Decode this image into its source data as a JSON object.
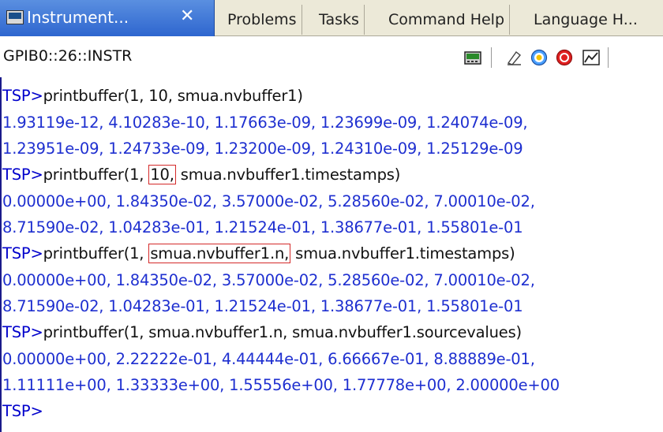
{
  "tabs": {
    "active": {
      "label": "Instrument...",
      "close": "✕"
    },
    "others": [
      "Problems",
      "Tasks",
      "Command Help",
      "Language H..."
    ]
  },
  "toolbar": {
    "address": "GPIB0::26::INSTR"
  },
  "console": {
    "prompt": "TSP>",
    "lines": [
      {
        "type": "cmd",
        "text": "printbuffer(1, 10, smua.nvbuffer1)"
      },
      {
        "type": "out",
        "text": "1.93119e-12, 4.10283e-10, 1.17663e-09, 1.23699e-09, 1.24074e-09,"
      },
      {
        "type": "out",
        "text": "1.23951e-09, 1.24733e-09, 1.23200e-09, 1.24310e-09, 1.25129e-09"
      },
      {
        "type": "cmd",
        "pre": "printbuffer(1, ",
        "highlight": "10,",
        "post": " smua.nvbuffer1.timestamps)"
      },
      {
        "type": "out",
        "text": "0.00000e+00, 1.84350e-02, 3.57000e-02, 5.28560e-02, 7.00010e-02,"
      },
      {
        "type": "out",
        "text": "8.71590e-02, 1.04283e-01, 1.21524e-01, 1.38677e-01, 1.55801e-01"
      },
      {
        "type": "cmd",
        "pre": "printbuffer(1, ",
        "highlight": "smua.nvbuffer1.n,",
        "post": " smua.nvbuffer1.timestamps)"
      },
      {
        "type": "out",
        "text": "0.00000e+00, 1.84350e-02, 3.57000e-02, 5.28560e-02, 7.00010e-02,"
      },
      {
        "type": "out",
        "text": "8.71590e-02, 1.04283e-01, 1.21524e-01, 1.38677e-01, 1.55801e-01"
      },
      {
        "type": "cmd",
        "text": "printbuffer(1, smua.nvbuffer1.n, smua.nvbuffer1.sourcevalues)"
      },
      {
        "type": "out",
        "text": "0.00000e+00, 2.22222e-01, 4.44444e-01, 6.66667e-01, 8.88889e-01,"
      },
      {
        "type": "out",
        "text": "1.11111e+00, 1.33333e+00, 1.55556e+00, 1.77778e+00, 2.00000e+00"
      },
      {
        "type": "prompt",
        "text": ""
      }
    ]
  },
  "colors": {
    "prompt": "#0000cc",
    "output": "#1e2fd0",
    "highlight_border": "#d42a2a",
    "active_tab": "#2e66cf"
  },
  "icons": [
    "terminal-icon",
    "close-icon",
    "instrument-icon",
    "eraser-icon",
    "target-icon",
    "stop-icon",
    "chart-icon"
  ]
}
